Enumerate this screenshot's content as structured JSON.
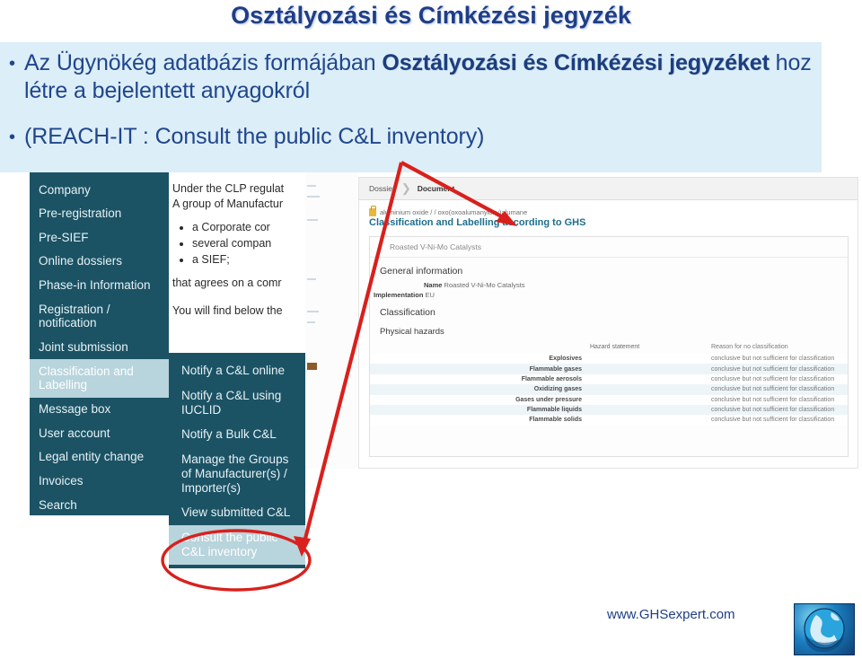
{
  "slide": {
    "title": "Osztályozási és Címkézési jegyzék",
    "bullets": [
      {
        "marker": "•",
        "parts": [
          {
            "text": "Az Ügynökég adatbázis formájában ",
            "bold": false
          },
          {
            "text": "Osztályozási és Címkézési jegyzéket",
            "bold": true
          },
          {
            "text": " hoz létre a  bejelentett anyagokról",
            "bold": false
          }
        ]
      },
      {
        "marker": "•",
        "parts": [
          {
            "text": "(REACH-IT : Consult the public C&L inventory)",
            "bold": false
          }
        ]
      }
    ]
  },
  "colors": {
    "title": "#1F3E87",
    "body_text": "#20468C",
    "panel_bg": "#DCEEF8",
    "nav_bg": "#1B5365",
    "nav_active_bg": "#B8D4DC",
    "annotation_red": "#D9201C",
    "panel_heading": "#1F6E8C"
  },
  "sidebar": {
    "items": [
      {
        "label": "Company",
        "active": false
      },
      {
        "label": "Pre-registration",
        "active": false
      },
      {
        "label": "Pre-SIEF",
        "active": false
      },
      {
        "label": "Online dossiers",
        "active": false
      },
      {
        "label": "Phase-in Information",
        "active": false
      },
      {
        "label": "Registration / notification",
        "active": false
      },
      {
        "label": "Joint submission",
        "active": false
      },
      {
        "label": "Classification and Labelling",
        "active": true
      },
      {
        "label": "Message box",
        "active": false
      },
      {
        "label": "User account",
        "active": false
      },
      {
        "label": "Legal entity change",
        "active": false
      },
      {
        "label": "Invoices",
        "active": false
      },
      {
        "label": "Search",
        "active": false
      }
    ]
  },
  "middle_column": {
    "intro_lines": [
      "Under the CLP regulat",
      "A group of Manufactur"
    ],
    "list_items": [
      "a Corporate cor",
      "several compan",
      "a SIEF;"
    ],
    "tail_lines": [
      "that agrees on a comr",
      "You will find below the"
    ]
  },
  "submenu": {
    "items": [
      {
        "label": "Notify a C&L online",
        "active": false
      },
      {
        "label": "Notify a C&L using IUCLID",
        "active": false
      },
      {
        "label": "Notify a Bulk C&L",
        "active": false
      },
      {
        "label": "Manage the Groups of Manufacturer(s) / Importer(s)",
        "active": false
      },
      {
        "label": "View submitted C&L",
        "active": false
      },
      {
        "label": "Consult the public C&L inventory",
        "active": true
      }
    ]
  },
  "right_panel": {
    "breadcrumb": {
      "items": [
        "Dossier",
        "Document"
      ],
      "separator": "❯"
    },
    "substance_line": "aluminium oxide / / oxo(oxoalumanyloxy)alumane",
    "heading": "Classification and Labelling according to GHS",
    "document_title": "Roasted V-Ni-Mo Catalysts",
    "general_information": {
      "section_title": "General information",
      "name_label": "Name",
      "name_value": "Roasted V-Ni-Mo Catalysts",
      "implementation_label": "Implementation",
      "implementation_value": "EU"
    },
    "classification_section_title": "Classification",
    "physical_hazards": {
      "section_title": "Physical hazards",
      "columns": [
        "",
        "Hazard statement",
        "Reason for no classification"
      ],
      "rows": [
        {
          "hazard": "Explosives",
          "statement": "",
          "reason": "conclusive but not sufficient for classification"
        },
        {
          "hazard": "Flammable gases",
          "statement": "",
          "reason": "conclusive but not sufficient for classification"
        },
        {
          "hazard": "Flammable aerosols",
          "statement": "",
          "reason": "conclusive but not sufficient for classification"
        },
        {
          "hazard": "Oxidizing gases",
          "statement": "",
          "reason": "conclusive but not sufficient for classification"
        },
        {
          "hazard": "Gases under pressure",
          "statement": "",
          "reason": "conclusive but not sufficient for classification"
        },
        {
          "hazard": "Flammable liquids",
          "statement": "",
          "reason": "conclusive but not sufficient for classification"
        },
        {
          "hazard": "Flammable solids",
          "statement": "",
          "reason": "conclusive but not sufficient for classification"
        }
      ]
    }
  },
  "annotations": {
    "arrow_to_heading": "red-arrow-pointing-to-classification-heading",
    "arrow_to_menu": "red-arrow-pointing-to-consult-public-inventory",
    "highlight_ellipse": "red-ellipse-around-consult-public-c-and-l-inventory"
  },
  "footer": {
    "url": "www.GHSexpert.com",
    "logo": "globe-logo"
  }
}
